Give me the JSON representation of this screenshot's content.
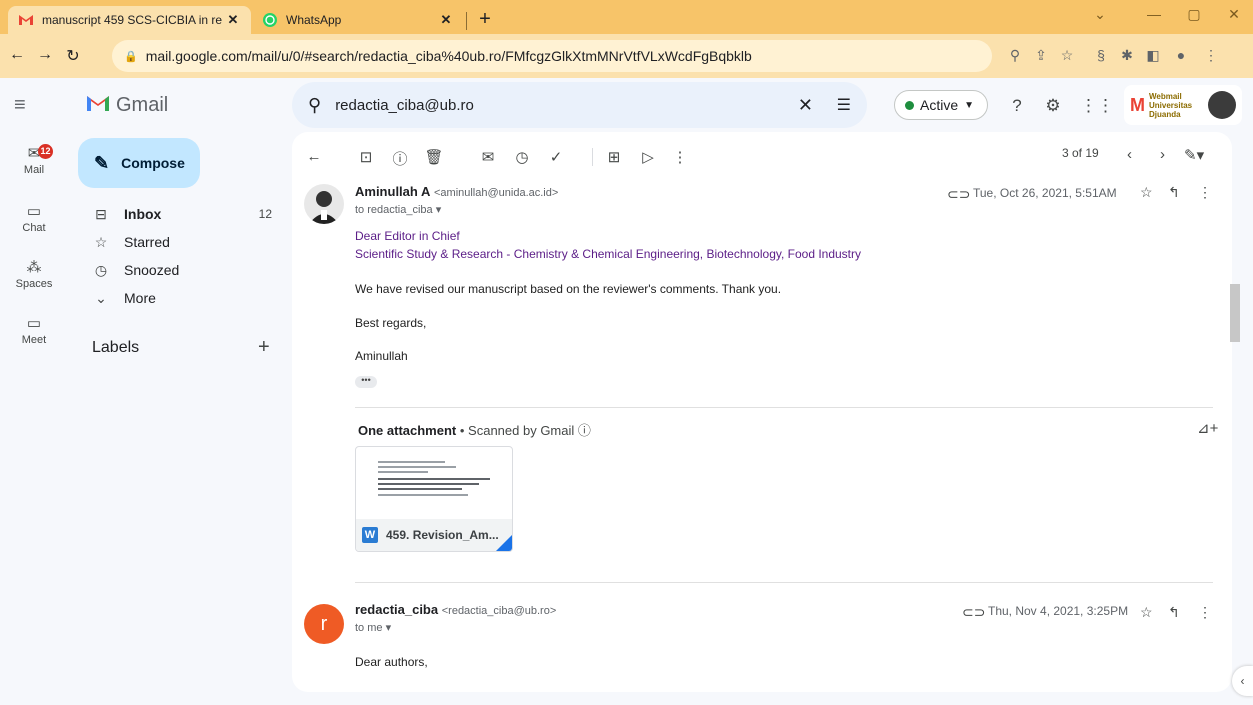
{
  "browser": {
    "tabs": [
      {
        "title": "manuscript 459 SCS-CICBIA in re",
        "active": true
      },
      {
        "title": "WhatsApp",
        "active": false
      }
    ],
    "url": "mail.google.com/mail/u/0/#search/redactia_ciba%40ub.ro/FMfcgzGlkXtmMNrVtfVLxWcdFgBqbklb"
  },
  "gmail": {
    "brand": "Gmail",
    "search_value": "redactia_ciba@ub.ro",
    "status_label": "Active",
    "brand_box_text": "Webmail Universitas Djuanda",
    "rail": {
      "mail_label": "Mail",
      "mail_badge": "12",
      "chat_label": "Chat",
      "spaces_label": "Spaces",
      "meet_label": "Meet"
    },
    "compose_label": "Compose",
    "nav": {
      "inbox": "Inbox",
      "inbox_count": "12",
      "starred": "Starred",
      "snoozed": "Snoozed",
      "more": "More"
    },
    "labels_title": "Labels",
    "pager": "3 of 19"
  },
  "messages": [
    {
      "sender": "Aminullah A",
      "email": "<aminullah@unida.ac.id>",
      "to": "to redactia_ciba",
      "date": "Tue, Oct 26, 2021, 5:51AM",
      "body": {
        "line1": "Dear Editor in Chief",
        "line2": "Scientific Study & Research - Chemistry & Chemical Engineering, Biotechnology, Food Industry",
        "line3": "We have revised our manuscript based on the reviewer's comments. Thank you.",
        "line4": "Best regards,",
        "line5": "Aminullah"
      },
      "attachment_heading": "One attachment",
      "attachment_scan": "Scanned by Gmail",
      "attachment_name": "459. Revision_Am..."
    },
    {
      "sender": "redactia_ciba",
      "avatar_letter": "r",
      "email": "<redactia_ciba@ub.ro>",
      "to": "to me",
      "date": "Thu, Nov 4, 2021, 3:25PM",
      "body": {
        "line1": "Dear authors,"
      }
    }
  ]
}
